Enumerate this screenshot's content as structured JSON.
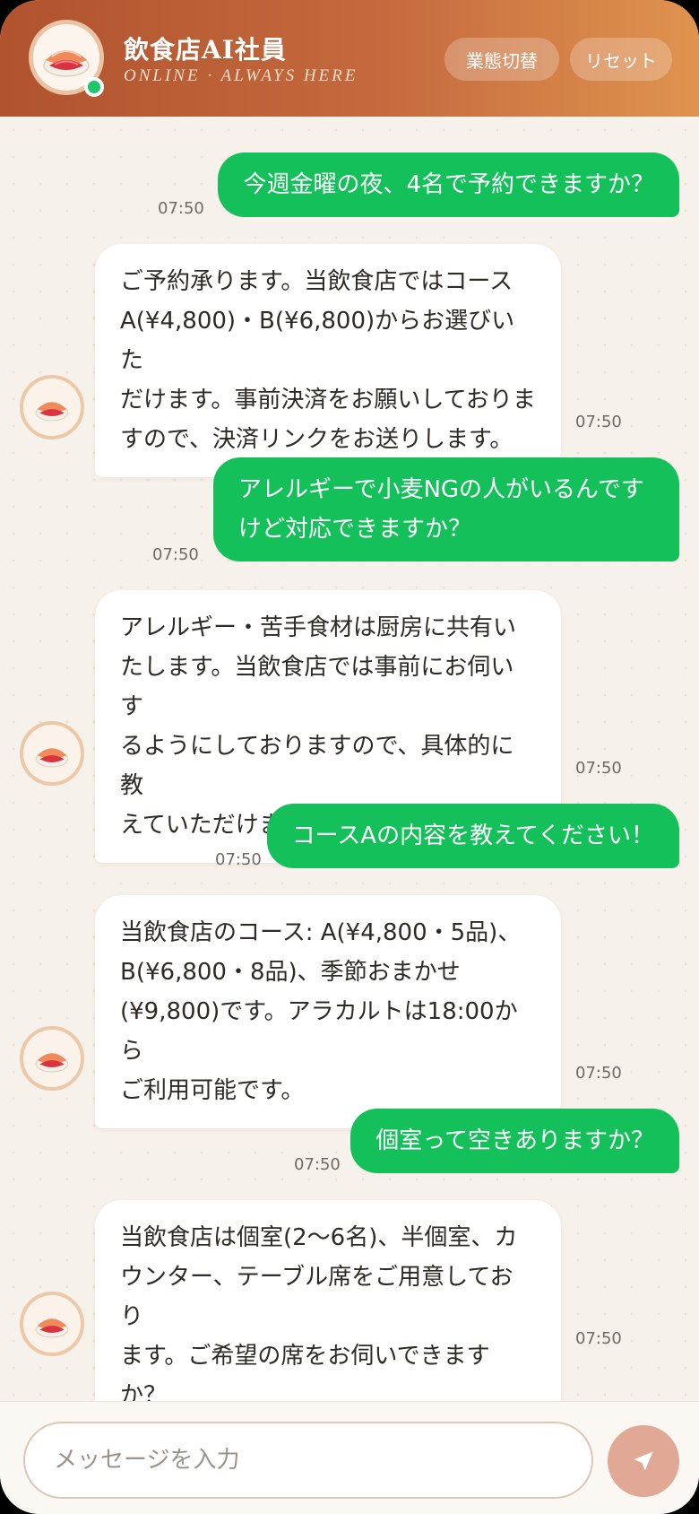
{
  "header": {
    "title": "飲食店AI社員",
    "subtitle": "ONLINE · ALWAYS HERE",
    "switch_label": "業態切替",
    "reset_label": "リセット"
  },
  "messages": [
    {
      "role": "user",
      "text": "今週金曜の夜、4名で予約できますか？",
      "time": "07:50"
    },
    {
      "role": "bot",
      "lines": [
        "ご予約承ります。当飲食店ではコース",
        "A(¥4,800)・B(¥6,800)からお選びいた",
        "だけます。事前決済をお願いしておりま",
        "すので、決済リンクをお送りします。"
      ],
      "time": "07:50"
    },
    {
      "role": "user",
      "lines": [
        "アレルギーで小麦NGの人がいるんです",
        "けど対応できますか？"
      ],
      "time": "07:50"
    },
    {
      "role": "bot",
      "lines": [
        "アレルギー・苦手食材は厨房に共有い",
        "たします。当飲食店では事前にお伺いす",
        "るようにしておりますので、具体的に教",
        "えていただけますか？"
      ],
      "time": "07:50"
    },
    {
      "role": "user",
      "text": "コースAの内容を教えてください！",
      "time": "07:50"
    },
    {
      "role": "bot",
      "lines": [
        "当飲食店のコース: A(¥4,800・5品)、",
        "B(¥6,800・8品)、季節おまかせ",
        "(¥9,800)です。アラカルトは18:00から",
        "ご利用可能です。"
      ],
      "time": "07:50"
    },
    {
      "role": "user",
      "text": "個室って空きありますか？",
      "time": "07:50"
    },
    {
      "role": "bot",
      "lines": [
        "当飲食店は個室(2〜6名)、半個室、カ",
        "ウンター、テーブル席をご用意しており",
        "ます。ご希望の席をお伺いできますか？"
      ],
      "time": "07:50"
    }
  ],
  "composer": {
    "placeholder": "メッセージを入力",
    "send_icon": "send-icon"
  },
  "colors": {
    "user_bubble": "#14c05a",
    "header_start": "#b0532e",
    "header_end": "#e0934f",
    "online": "#1fc46b"
  }
}
